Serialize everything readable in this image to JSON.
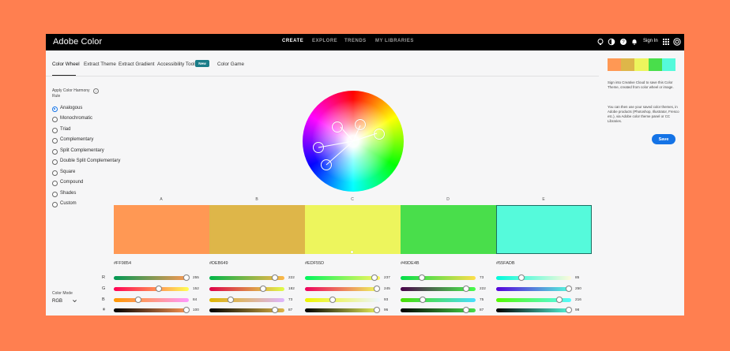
{
  "app": {
    "title": "Adobe Color"
  },
  "header": {
    "nav": [
      "CREATE",
      "EXPLORE",
      "TRENDS",
      "MY LIBRARIES"
    ],
    "signin": "Sign In",
    "icons": [
      "lightbulb-icon",
      "colorblind-icon",
      "help-icon",
      "bell-icon",
      "apps-icon",
      "creative-cloud-icon"
    ]
  },
  "subnav": {
    "tabs": [
      "Color Wheel",
      "Extract Theme",
      "Extract Gradient",
      "Accessibility Tools",
      "Color Game"
    ],
    "active": "Color Wheel",
    "badge": "New"
  },
  "harmony": {
    "label_line1": "Apply Color Harmony",
    "label_line2": "Rule",
    "selected": "Analogous",
    "rules": [
      "Analogous",
      "Monochromatic",
      "Triad",
      "Complementary",
      "Split Complementary",
      "Double Split Complementary",
      "Square",
      "Compound",
      "Shades",
      "Custom"
    ]
  },
  "colors": {
    "letters": [
      "A",
      "B",
      "C",
      "D",
      "E"
    ],
    "hex": [
      "#FF9854",
      "#DEB649",
      "#EDF55D",
      "#49DE4B",
      "#55FADB"
    ],
    "hex_labels": [
      "#FF9854",
      "#DEB649",
      "#EDF55D",
      "#49DE4B",
      "#55FADB"
    ],
    "selected_index": 4
  },
  "sliders": {
    "channels": [
      "R",
      "G",
      "B",
      "☀"
    ],
    "values": [
      [
        "255",
        "152",
        "84",
        "100"
      ],
      [
        "222",
        "182",
        "73",
        "87"
      ],
      [
        "237",
        "245",
        "93",
        "96"
      ],
      [
        "73",
        "222",
        "75",
        "87"
      ],
      [
        "85",
        "250",
        "216",
        "98"
      ]
    ]
  },
  "mode": {
    "label": "Color Mode",
    "value": "RGB"
  },
  "panel": {
    "text1": "Sign into Creative Cloud to save this Color Theme, created from color wheel or image.",
    "text2": "You can then use your saved color themes, in Adobe products (Photoshop, Illustrator, Fresco etc.), via Adobe color theme panel or CC Libraries.",
    "save": "Save"
  }
}
